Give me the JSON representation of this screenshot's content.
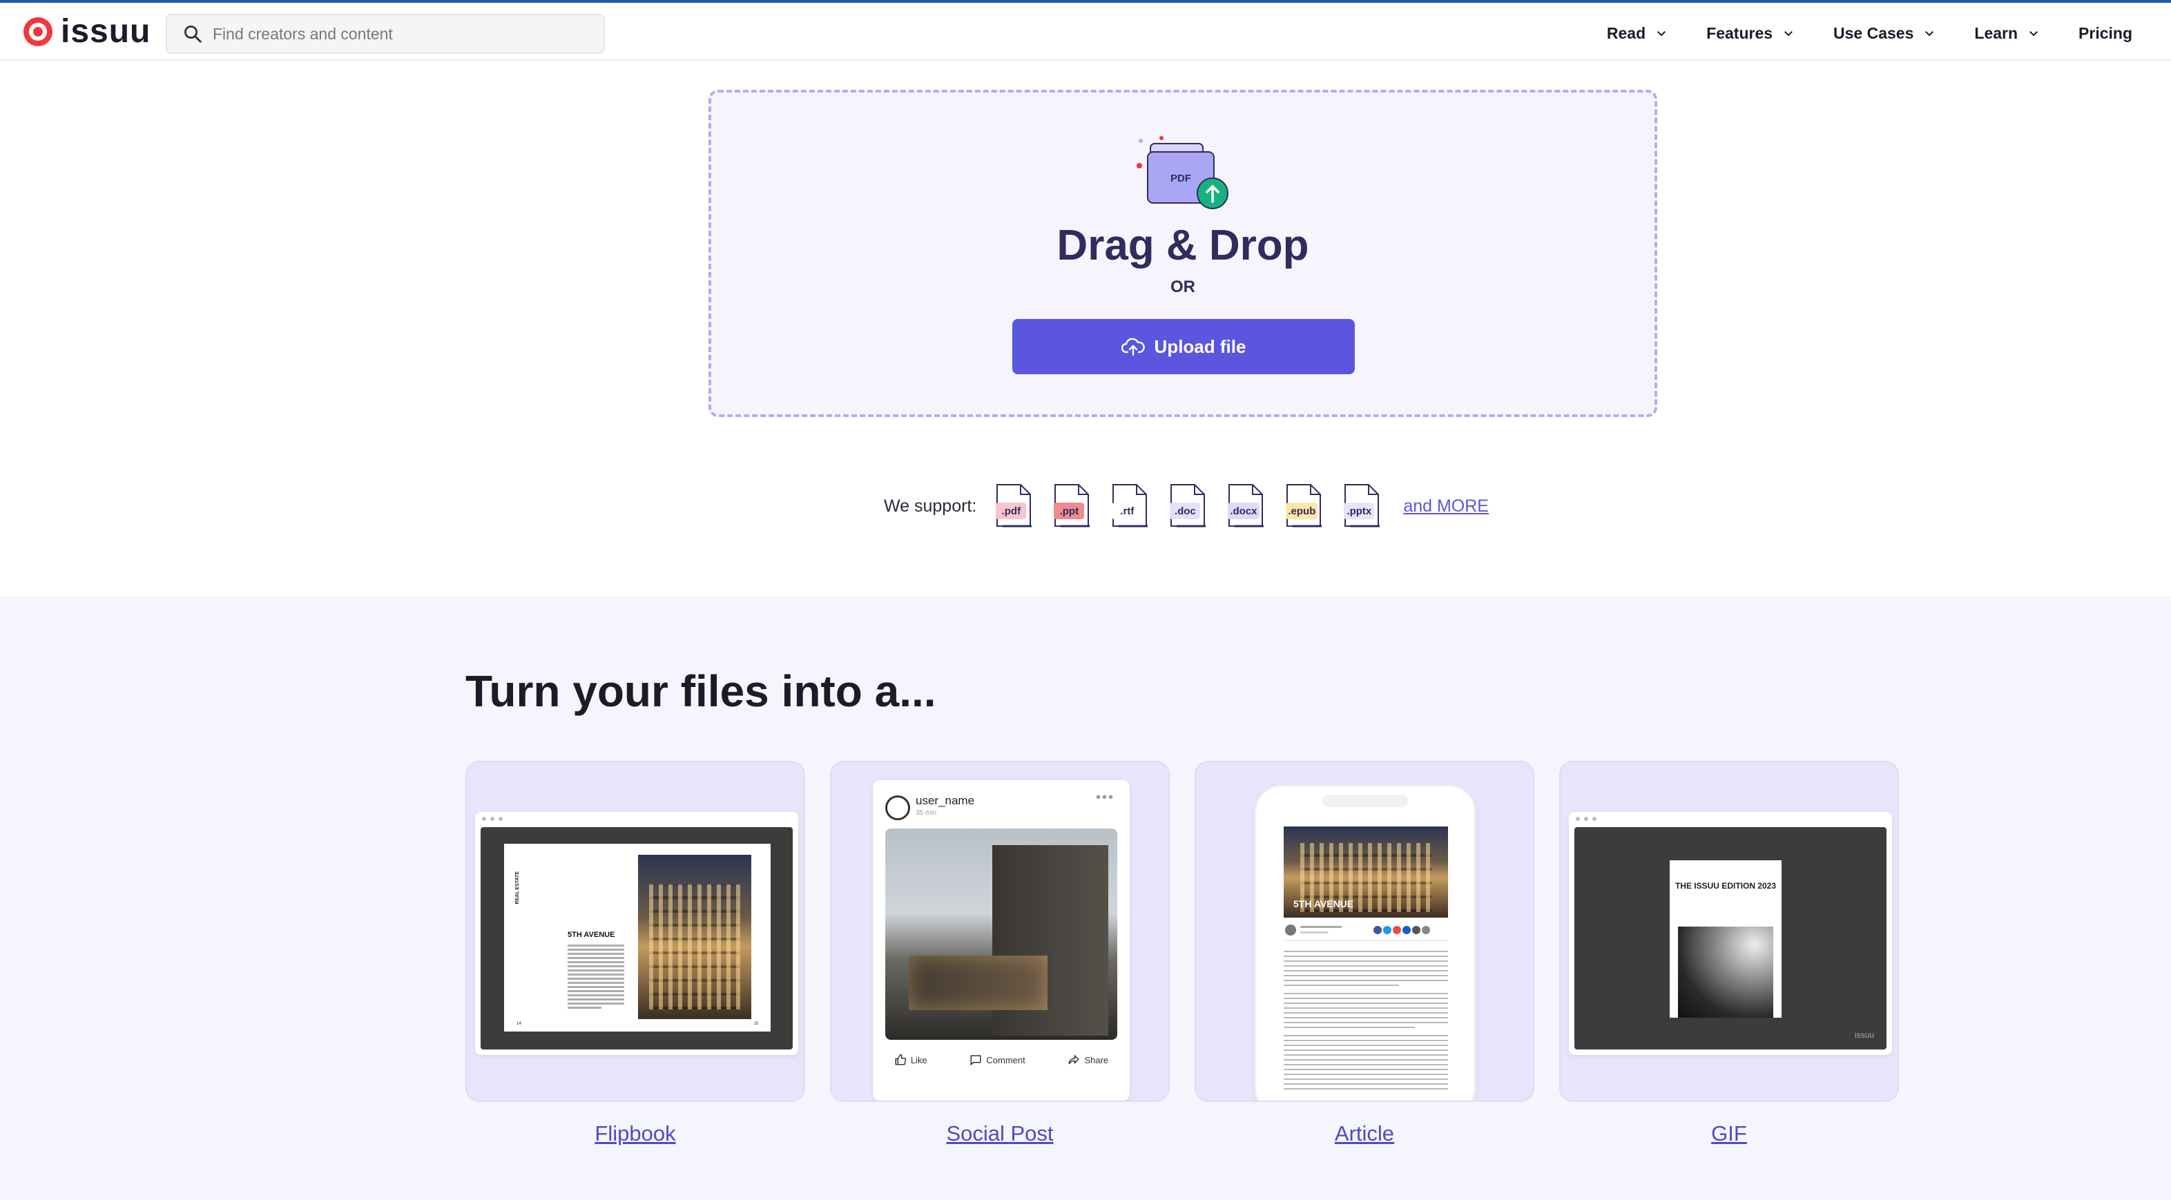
{
  "header": {
    "logo_text": "issuu",
    "search_placeholder": "Find creators and content",
    "nav": [
      {
        "label": "Read",
        "has_dropdown": true
      },
      {
        "label": "Features",
        "has_dropdown": true
      },
      {
        "label": "Use Cases",
        "has_dropdown": true
      },
      {
        "label": "Learn",
        "has_dropdown": true
      },
      {
        "label": "Pricing",
        "has_dropdown": false
      }
    ]
  },
  "upload": {
    "icon_label": "PDF",
    "title": "Drag & Drop",
    "or_text": "OR",
    "button_label": "Upload file"
  },
  "support": {
    "label": "We support:",
    "formats": [
      {
        "ext": ".pdf",
        "color": "#f7c6cc"
      },
      {
        "ext": ".ppt",
        "color": "#f08a8f"
      },
      {
        "ext": ".rtf",
        "color": "#ffffff"
      },
      {
        "ext": ".doc",
        "color": "#e3e2fb"
      },
      {
        "ext": ".docx",
        "color": "#dcdbf8"
      },
      {
        "ext": ".epub",
        "color": "#fbe6a6"
      },
      {
        "ext": ".pptx",
        "color": "#e6e5fb"
      }
    ],
    "more_link": "and MORE"
  },
  "section": {
    "title": "Turn your files into a...",
    "cards": [
      {
        "label": "Flipbook",
        "preview": {
          "side_label": "REAL ESTATE",
          "heading": "5TH AVENUE",
          "page_left": "14",
          "page_right": "15"
        }
      },
      {
        "label": "Social Post",
        "preview": {
          "user": "user_name",
          "time": "35 min",
          "actions": [
            "Like",
            "Comment",
            "Share"
          ]
        }
      },
      {
        "label": "Article",
        "preview": {
          "heading": "5TH AVENUE"
        }
      },
      {
        "label": "GIF",
        "preview": {
          "title": "THE ISSUU EDITION 2023",
          "brand": "issuu"
        }
      }
    ]
  },
  "colors": {
    "accent": "#5a56e0",
    "brand_red": "#f2373b",
    "dropzone_border": "#b2adf0",
    "section_bg": "#f5f5fd"
  }
}
